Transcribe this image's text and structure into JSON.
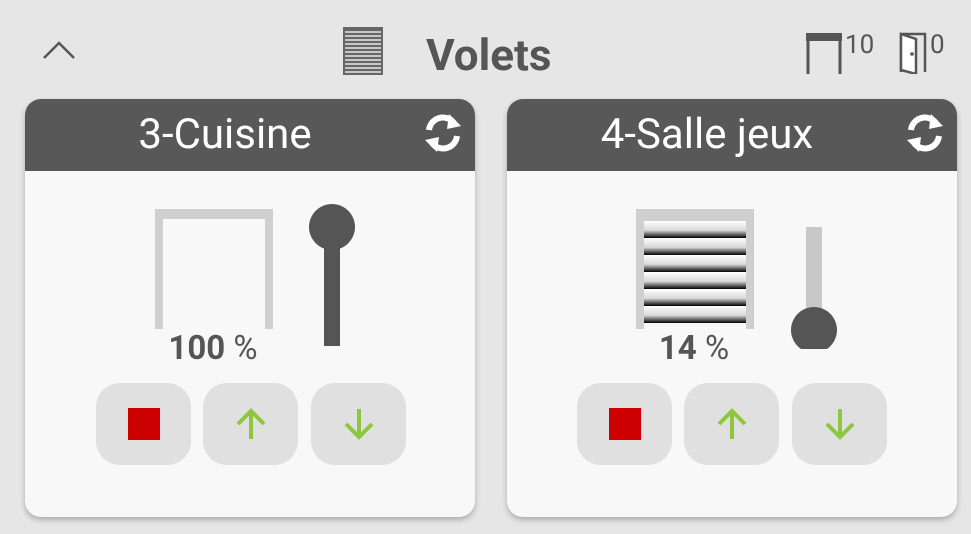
{
  "page": {
    "title": "Volets",
    "open_count": "10",
    "door_count": "0"
  },
  "colors": {
    "header_bg": "#585858",
    "card_bg": "#f8f8f8",
    "page_bg": "#e6e6e6",
    "stop_red": "#cc0000",
    "arrow_green": "#8dc63f",
    "slider_dark": "#555555",
    "slider_light": "#c8c8c8"
  },
  "icons": {
    "collapse": "chevron-up-icon",
    "header": "shutter-icon",
    "open_count": "open-shutter-icon",
    "door_count": "door-icon",
    "refresh": "refresh-icon",
    "stop": "stop-icon",
    "up": "arrow-up-icon",
    "down": "arrow-down-icon"
  },
  "cards": [
    {
      "name": "3-Cuisine",
      "percent": "100",
      "percent_unit": "%",
      "level": 1.0,
      "state": "open"
    },
    {
      "name": "4-Salle jeux",
      "percent": "14",
      "percent_unit": "%",
      "level": 0.14,
      "state": "closed"
    }
  ]
}
